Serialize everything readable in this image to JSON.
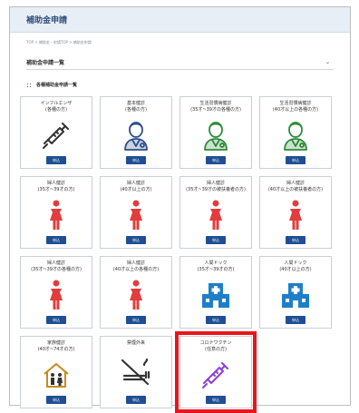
{
  "header": {
    "title": "補助金申請"
  },
  "breadcrumb": "TOP > 補助金・申請TOP > 補助金申請",
  "dropdown": {
    "label": "補助金申請一覧",
    "chevron": "⌄"
  },
  "section": {
    "title": "各種補助金申請一覧"
  },
  "apply_label": "申込",
  "cards": [
    {
      "l1": "インフルエンザ",
      "l2": "(各種の方)",
      "icon": "syringe-icon",
      "icon_color": "#333333"
    },
    {
      "l1": "基本健診",
      "l2": "(各種の方)",
      "icon": "doctor-icon",
      "icon_color": "#2e4f8c"
    },
    {
      "l1": "生活習慣病健診",
      "l2": "(35才~39才の各種の方)",
      "icon": "doctor-icon",
      "icon_color": "#2e8a3a"
    },
    {
      "l1": "生活習慣病健診",
      "l2": "(40才以上の各種の方)",
      "icon": "doctor-icon",
      "icon_color": "#2e8a3a"
    },
    {
      "l1": "婦人健診",
      "l2": "(35才~39才の方)",
      "icon": "woman-icon",
      "icon_color": "#e23c3c"
    },
    {
      "l1": "婦人健診",
      "l2": "(40才以上の方)",
      "icon": "woman-icon",
      "icon_color": "#e23c3c"
    },
    {
      "l1": "婦人健診",
      "l2": "(35才~39才の被扶養者の方)",
      "icon": "woman-icon",
      "icon_color": "#e23c3c"
    },
    {
      "l1": "婦人健診",
      "l2": "(40才以上の被扶養者の方)",
      "icon": "woman-icon",
      "icon_color": "#e23c3c"
    },
    {
      "l1": "婦人健診",
      "l2": "(35才~39才の各種の方)",
      "icon": "woman-icon",
      "icon_color": "#e23c3c"
    },
    {
      "l1": "婦人健診",
      "l2": "(40才以上の各種の方)",
      "icon": "woman-icon",
      "icon_color": "#e23c3c"
    },
    {
      "l1": "人間ドック",
      "l2": "(35才~39才の方)",
      "icon": "hospital-icon",
      "icon_color": "#1e7fc8"
    },
    {
      "l1": "人間ドック",
      "l2": "(40才以上の方)",
      "icon": "hospital-icon",
      "icon_color": "#1e7fc8"
    },
    {
      "l1": "家族健診",
      "l2": "(40才~74才の方)",
      "icon": "family-house-icon",
      "icon_color": "#c98a1a"
    },
    {
      "l1": "禁煙外来",
      "l2": "",
      "icon": "no-smoking-icon",
      "icon_color": "#333333"
    },
    {
      "l1": "コロナワクチン",
      "l2": "(任意の方)",
      "icon": "syringe-icon",
      "icon_color": "#8b3fd6",
      "highlight": true
    }
  ]
}
